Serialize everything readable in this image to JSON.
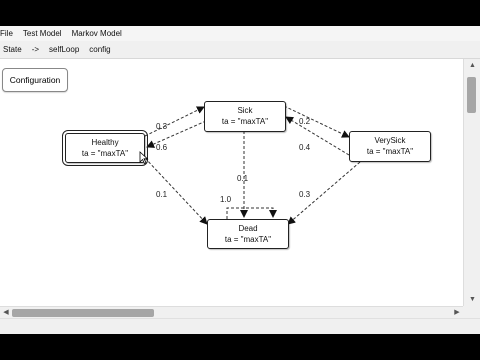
{
  "menu": [
    "File",
    "Test Model",
    "Markov Model"
  ],
  "toolbar": [
    "State",
    "->",
    "selfLoop",
    "config"
  ],
  "config_button": "Configuration",
  "nodes": {
    "healthy": {
      "name": "Healthy",
      "ta": "ta = \"maxTA\""
    },
    "sick": {
      "name": "Sick",
      "ta": "ta = \"maxTA\""
    },
    "verysick": {
      "name": "VerySick",
      "ta": "ta = \"maxTA\""
    },
    "dead": {
      "name": "Dead",
      "ta": "ta = \"maxTA\""
    }
  },
  "edge_labels": {
    "healthy_sick": "0.3",
    "sick_healthy": "0.6",
    "healthy_dead": "0.1",
    "sick_verysick": "0.2",
    "verysick_sick": "0.4",
    "sick_dead": "0.1",
    "verysick_dead": "0.3",
    "dead_self": "1.0"
  }
}
